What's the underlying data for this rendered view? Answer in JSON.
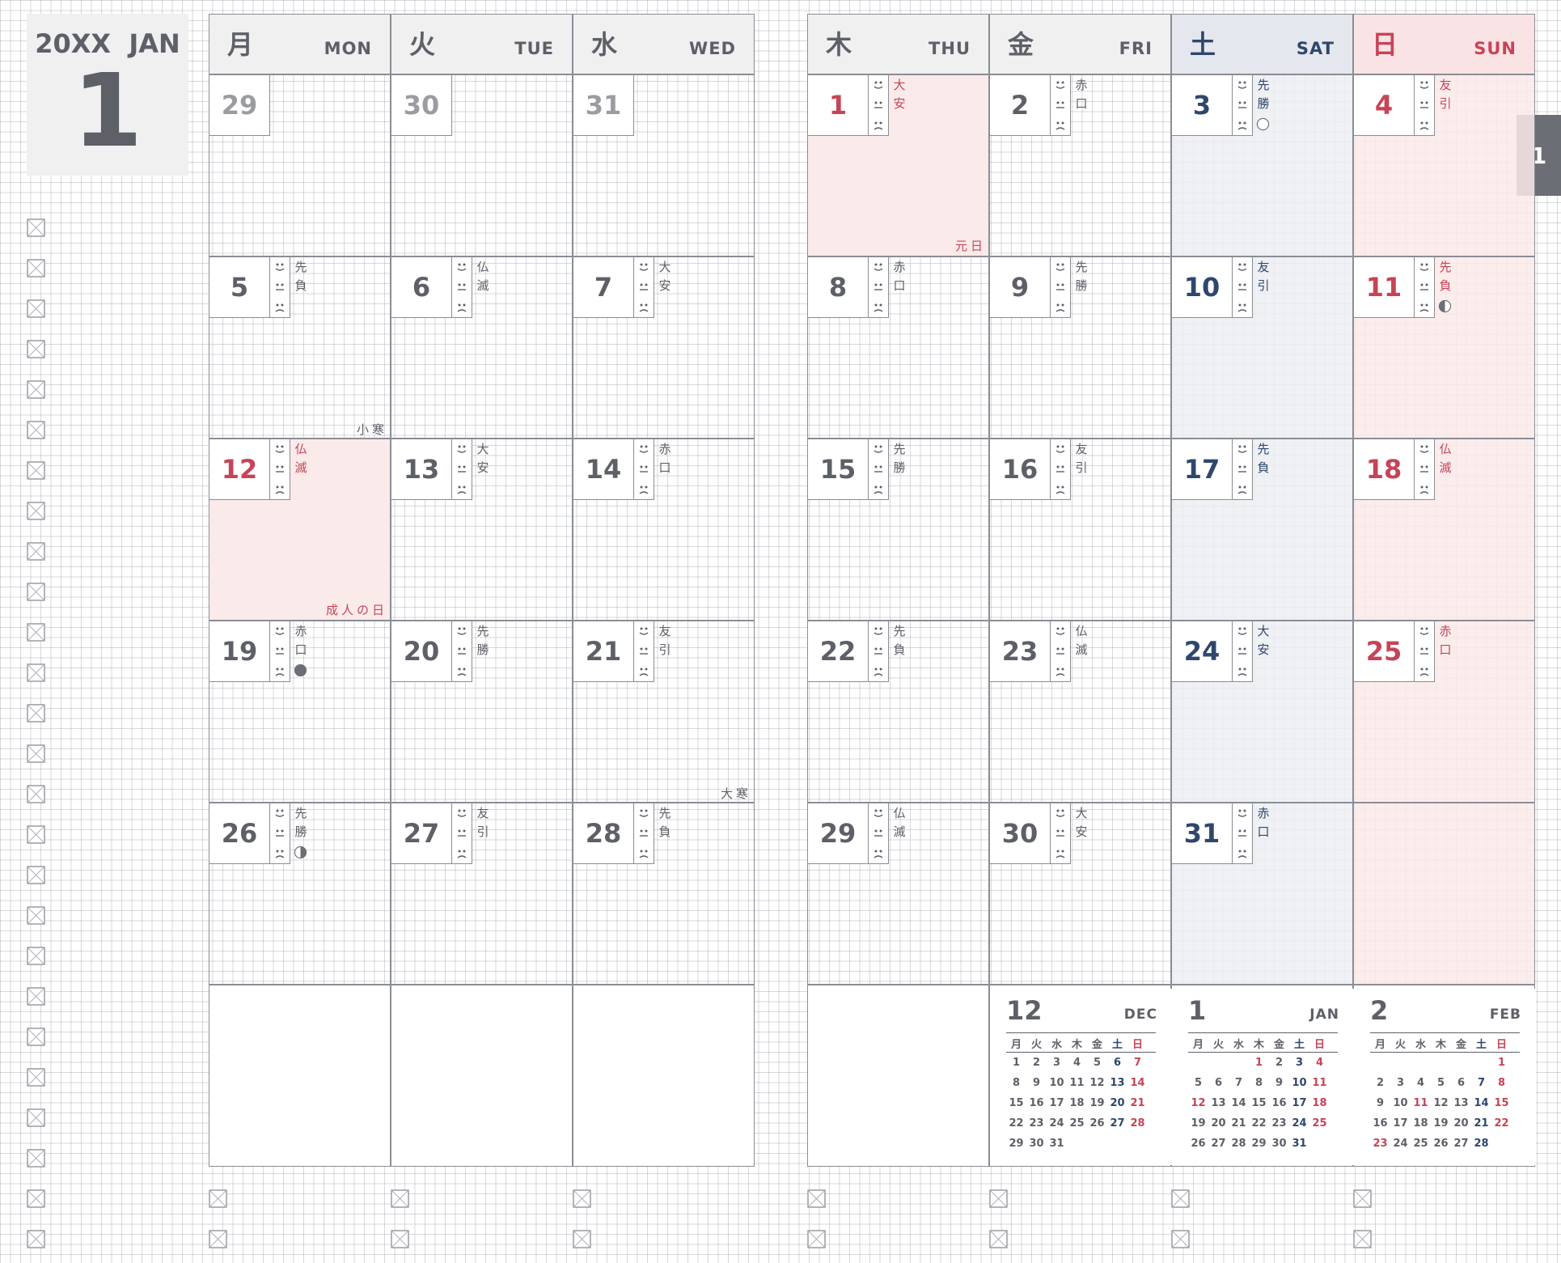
{
  "header": {
    "year_month": "20XX  JAN",
    "month_number": "1",
    "tab_label": "1"
  },
  "colors": {
    "text": "#5e6068",
    "red": "#c64457",
    "navy": "#2f476c",
    "gray": "#9a9ca2",
    "sat_bg": "#eceef3",
    "sun_bg": "#fbeaea"
  },
  "weekdays": [
    {
      "jp": "月",
      "en": "MON"
    },
    {
      "jp": "火",
      "en": "TUE"
    },
    {
      "jp": "水",
      "en": "WED"
    },
    {
      "jp": "木",
      "en": "THU"
    },
    {
      "jp": "金",
      "en": "FRI"
    },
    {
      "jp": "土",
      "en": "SAT"
    },
    {
      "jp": "日",
      "en": "SUN"
    }
  ],
  "weeks": [
    [
      {
        "day": "29",
        "muted": true
      },
      {
        "day": "30",
        "muted": true
      },
      {
        "day": "31",
        "muted": true
      },
      {
        "day": "1",
        "rokuyo": [
          "大",
          "安"
        ],
        "holiday": true,
        "note": "元日"
      },
      {
        "day": "2",
        "rokuyo": [
          "赤",
          "口"
        ]
      },
      {
        "day": "3",
        "rokuyo": [
          "先",
          "勝"
        ],
        "moon": "full"
      },
      {
        "day": "4",
        "rokuyo": [
          "友",
          "引"
        ]
      }
    ],
    [
      {
        "day": "5",
        "rokuyo": [
          "先",
          "負"
        ]
      },
      {
        "day": "6",
        "rokuyo": [
          "仏",
          "滅"
        ]
      },
      {
        "day": "7",
        "rokuyo": [
          "大",
          "安"
        ]
      },
      {
        "day": "8",
        "rokuyo": [
          "赤",
          "口"
        ]
      },
      {
        "day": "9",
        "rokuyo": [
          "先",
          "勝"
        ]
      },
      {
        "day": "10",
        "rokuyo": [
          "友",
          "引"
        ]
      },
      {
        "day": "11",
        "rokuyo": [
          "先",
          "負"
        ],
        "moon": "last"
      }
    ],
    [
      {
        "day": "12",
        "rokuyo": [
          "仏",
          "滅"
        ],
        "holiday": true,
        "note": "成人の日"
      },
      {
        "day": "13",
        "rokuyo": [
          "大",
          "安"
        ]
      },
      {
        "day": "14",
        "rokuyo": [
          "赤",
          "口"
        ]
      },
      {
        "day": "15",
        "rokuyo": [
          "先",
          "勝"
        ]
      },
      {
        "day": "16",
        "rokuyo": [
          "友",
          "引"
        ]
      },
      {
        "day": "17",
        "rokuyo": [
          "先",
          "負"
        ]
      },
      {
        "day": "18",
        "rokuyo": [
          "仏",
          "滅"
        ]
      }
    ],
    [
      {
        "day": "19",
        "rokuyo": [
          "赤",
          "口"
        ],
        "moon": "new"
      },
      {
        "day": "20",
        "rokuyo": [
          "先",
          "勝"
        ]
      },
      {
        "day": "21",
        "rokuyo": [
          "友",
          "引"
        ]
      },
      {
        "day": "22",
        "rokuyo": [
          "先",
          "負"
        ]
      },
      {
        "day": "23",
        "rokuyo": [
          "仏",
          "滅"
        ]
      },
      {
        "day": "24",
        "rokuyo": [
          "大",
          "安"
        ]
      },
      {
        "day": "25",
        "rokuyo": [
          "赤",
          "口"
        ]
      }
    ],
    [
      {
        "day": "26",
        "rokuyo": [
          "先",
          "勝"
        ],
        "moon": "first"
      },
      {
        "day": "27",
        "rokuyo": [
          "友",
          "引"
        ]
      },
      {
        "day": "28",
        "rokuyo": [
          "先",
          "負"
        ]
      },
      {
        "day": "29",
        "rokuyo": [
          "仏",
          "滅"
        ]
      },
      {
        "day": "30",
        "rokuyo": [
          "大",
          "安"
        ]
      },
      {
        "day": "31",
        "rokuyo": [
          "赤",
          "口"
        ]
      },
      null
    ]
  ],
  "week_notes": [
    {
      "week": 1,
      "col": 0,
      "text": "小寒"
    },
    {
      "week": 3,
      "col": 2,
      "text": "大寒"
    }
  ],
  "mini_calendars": [
    {
      "num": "12",
      "en": "DEC",
      "weekdays": [
        "月",
        "火",
        "水",
        "木",
        "金",
        "土",
        "日"
      ],
      "rows": [
        [
          "1",
          "2",
          "3",
          "4",
          "5",
          "6",
          "7"
        ],
        [
          "8",
          "9",
          "10",
          "11",
          "12",
          "13",
          "14"
        ],
        [
          "15",
          "16",
          "17",
          "18",
          "19",
          "20",
          "21"
        ],
        [
          "22",
          "23",
          "24",
          "25",
          "26",
          "27",
          "28"
        ],
        [
          "29",
          "30",
          "31",
          "",
          "",
          "",
          ""
        ]
      ]
    },
    {
      "num": "1",
      "en": "JAN",
      "weekdays": [
        "月",
        "火",
        "水",
        "木",
        "金",
        "土",
        "日"
      ],
      "rows": [
        [
          "",
          "",
          "",
          "1",
          "2",
          "3",
          "4"
        ],
        [
          "5",
          "6",
          "7",
          "8",
          "9",
          "10",
          "11"
        ],
        [
          "12",
          "13",
          "14",
          "15",
          "16",
          "17",
          "18"
        ],
        [
          "19",
          "20",
          "21",
          "22",
          "23",
          "24",
          "25"
        ],
        [
          "26",
          "27",
          "28",
          "29",
          "30",
          "31",
          ""
        ]
      ],
      "red_days": [
        "1",
        "12"
      ]
    },
    {
      "num": "2",
      "en": "FEB",
      "weekdays": [
        "月",
        "火",
        "水",
        "木",
        "金",
        "土",
        "日"
      ],
      "rows": [
        [
          "",
          "",
          "",
          "",
          "",
          "",
          "1"
        ],
        [
          "2",
          "3",
          "4",
          "5",
          "6",
          "7",
          "8"
        ],
        [
          "9",
          "10",
          "11",
          "12",
          "13",
          "14",
          "15"
        ],
        [
          "16",
          "17",
          "18",
          "19",
          "20",
          "21",
          "22"
        ],
        [
          "23",
          "24",
          "25",
          "26",
          "27",
          "28",
          ""
        ]
      ],
      "red_days": [
        "11",
        "23"
      ]
    }
  ]
}
